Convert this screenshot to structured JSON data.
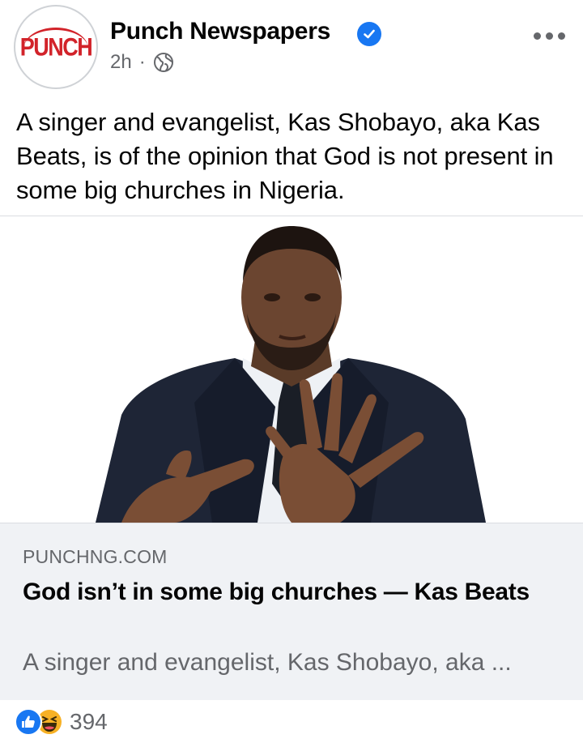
{
  "post": {
    "page_name": "Punch Newspapers",
    "logo_text": "PUNCH",
    "time": "2h",
    "separator": "·",
    "text": "A singer and evangelist, Kas Shobayo, aka Kas Beats, is of the opinion that God is not present in some big churches in Nigeria."
  },
  "link": {
    "domain": "PUNCHNG.COM",
    "title": "God isn’t in some big churches — Kas Beats",
    "description": "A singer and evangelist, Kas Shobayo, aka ..."
  },
  "reactions": {
    "count": "394",
    "types": [
      "like-icon",
      "haha-icon"
    ]
  },
  "colors": {
    "brand_red": "#d2232a",
    "facebook_blue": "#1877f2",
    "secondary_text": "#65676b",
    "link_box_bg": "#f0f2f5"
  }
}
